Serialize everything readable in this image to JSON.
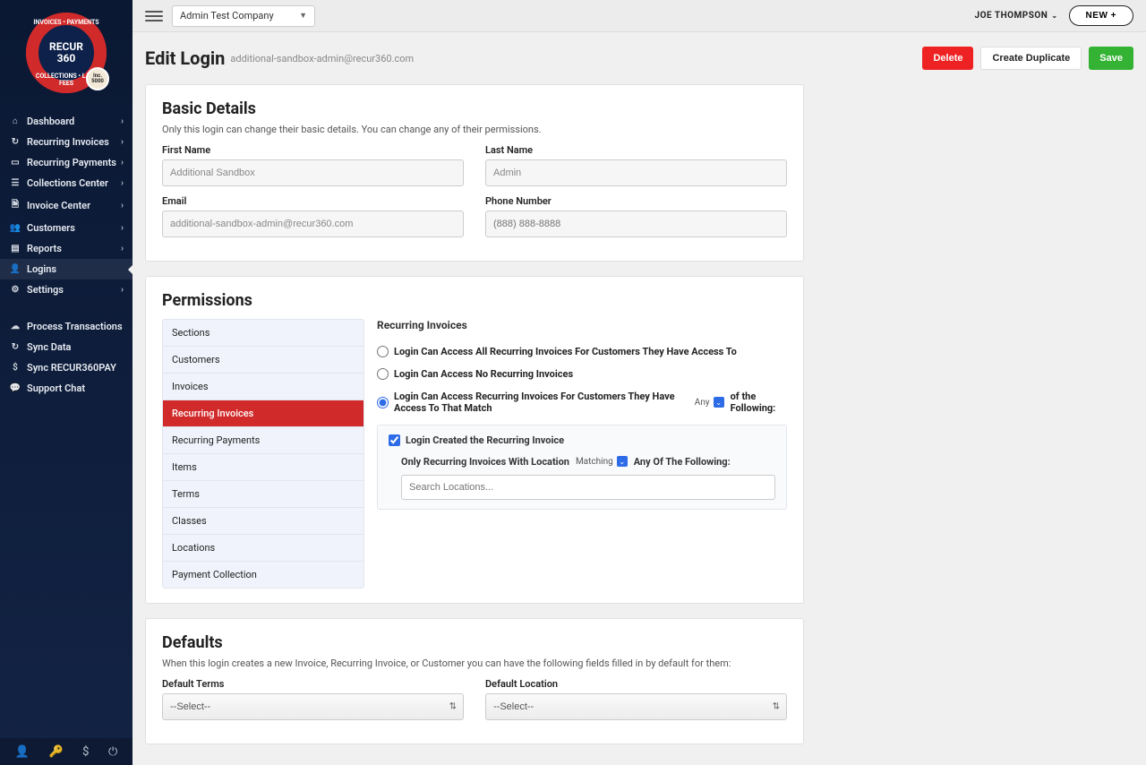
{
  "brand": {
    "name": "RECUR\n360",
    "ring_words": [
      "INVOICES",
      "PAYMENTS",
      "LATE FEES",
      "COLLECTIONS"
    ],
    "badge": "Inc.\n5000"
  },
  "topbar": {
    "company": "Admin Test Company",
    "user": "JOE THOMPSON",
    "new_label": "NEW +"
  },
  "nav_primary": [
    {
      "icon": "⌂",
      "label": "Dashboard",
      "chev": true
    },
    {
      "icon": "↻",
      "label": "Recurring Invoices",
      "chev": true
    },
    {
      "icon": "▭",
      "label": "Recurring Payments",
      "chev": true
    },
    {
      "icon": "☰",
      "label": "Collections Center",
      "chev": true
    },
    {
      "icon": "🗎",
      "label": "Invoice Center",
      "chev": true
    },
    {
      "icon": "👥",
      "label": "Customers",
      "chev": true
    },
    {
      "icon": "▤",
      "label": "Reports",
      "chev": true
    },
    {
      "icon": "👤",
      "label": "Logins",
      "chev": false,
      "active": true
    },
    {
      "icon": "⚙",
      "label": "Settings",
      "chev": true
    }
  ],
  "nav_secondary": [
    {
      "icon": "☁",
      "label": "Process Transactions"
    },
    {
      "icon": "↻",
      "label": "Sync Data"
    },
    {
      "icon": "$",
      "label": "Sync RECUR360PAY"
    },
    {
      "icon": "💬",
      "label": "Support Chat"
    }
  ],
  "page": {
    "title": "Edit Login",
    "subtitle": "additional-sandbox-admin@recur360.com",
    "actions": {
      "delete": "Delete",
      "duplicate": "Create Duplicate",
      "save": "Save"
    }
  },
  "basic": {
    "heading": "Basic Details",
    "hint": "Only this login can change their basic details. You can change any of their permissions.",
    "first_name_label": "First Name",
    "first_name_value": "Additional Sandbox",
    "last_name_label": "Last Name",
    "last_name_value": "Admin",
    "email_label": "Email",
    "email_value": "additional-sandbox-admin@recur360.com",
    "phone_label": "Phone Number",
    "phone_placeholder": "(888) 888-8888"
  },
  "permissions": {
    "heading": "Permissions",
    "tabs": [
      "Sections",
      "Customers",
      "Invoices",
      "Recurring Invoices",
      "Recurring Payments",
      "Items",
      "Terms",
      "Classes",
      "Locations",
      "Payment Collection"
    ],
    "active_tab": "Recurring Invoices",
    "content_heading": "Recurring Invoices",
    "opt1": "Login Can Access All Recurring Invoices For Customers They Have Access To",
    "opt2": "Login Can Access No Recurring Invoices",
    "opt3_pre": "Login Can Access Recurring Invoices For Customers They Have Access To That Match",
    "opt3_sel": "Any",
    "opt3_post": "of the Following:",
    "chk1": "Login Created the Recurring Invoice",
    "loc_pre": "Only Recurring Invoices With Location",
    "loc_sel": "Matching",
    "loc_post": "Any Of The Following:",
    "search_placeholder": "Search Locations..."
  },
  "defaults": {
    "heading": "Defaults",
    "hint": "When this login creates a new Invoice, Recurring Invoice, or Customer you can have the following fields filled in by default for them:",
    "terms_label": "Default Terms",
    "terms_value": "--Select--",
    "location_label": "Default Location",
    "location_value": "--Select--"
  }
}
